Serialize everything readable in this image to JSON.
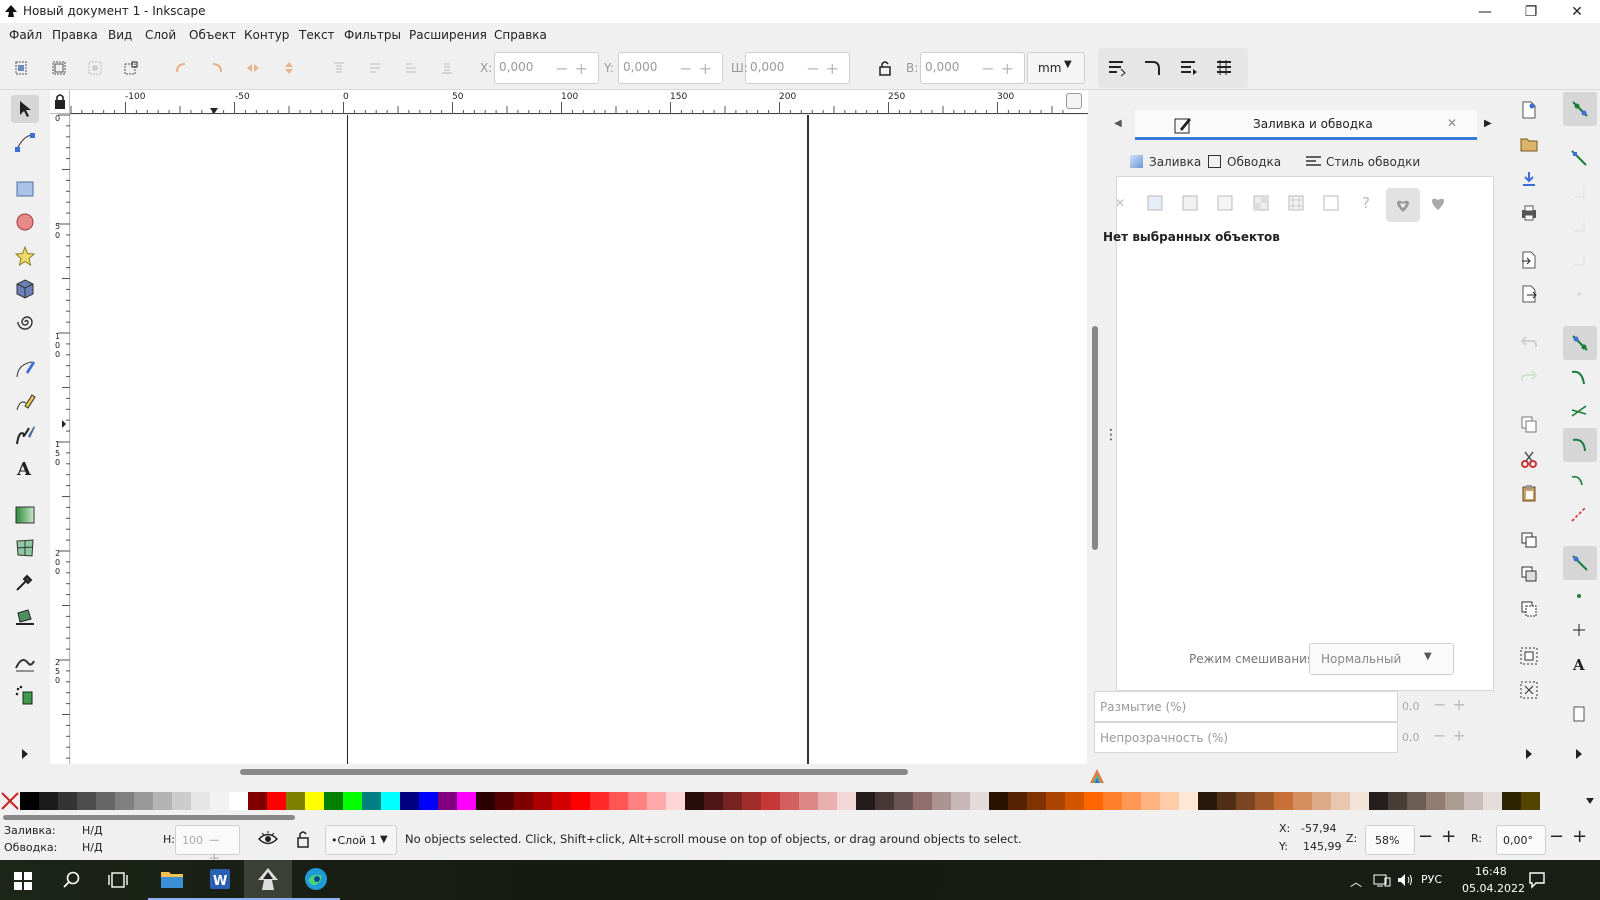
{
  "window": {
    "title": "Новый документ 1 - Inkscape",
    "min": "—",
    "max": "❐",
    "close": "✕"
  },
  "menu": [
    "Файл",
    "Правка",
    "Вид",
    "Слой",
    "Объект",
    "Контур",
    "Текст",
    "Фильтры",
    "Расширения",
    "Справка"
  ],
  "toolbar": {
    "x_label": "X:",
    "x_value": "0,000",
    "y_label": "Y:",
    "y_value": "0,000",
    "w_label": "Ш:",
    "w_value": "0,000",
    "h_label": "В:",
    "h_value": "0,000",
    "unit": "mm"
  },
  "ruler": {
    "h_ticks": [
      "-100",
      "-50",
      "0",
      "50",
      "100",
      "150",
      "200",
      "250",
      "300"
    ],
    "v_ticks": [
      "0",
      "50",
      "100",
      "150",
      "200",
      "250"
    ]
  },
  "dock": {
    "title": "Заливка и обводка",
    "tabs": [
      "Заливка",
      "Обводка",
      "Стиль обводки"
    ],
    "fill_buttons": [
      "none-icon",
      "flat-color-icon",
      "linear-gradient-icon",
      "radial-gradient-icon",
      "mesh-icon",
      "pattern-icon",
      "swatch-icon",
      "unset-icon",
      "winding-evenodd-icon",
      "winding-nonzero-icon"
    ],
    "unset_glyph": "?",
    "message": "Нет выбранных объектов",
    "blend_label": "Режим смешивания:",
    "blend_value": "Нормальный",
    "blur_label": "Размытие (%)",
    "blur_value": "0,0",
    "opacity_label": "Непрозрачность (%)",
    "opacity_value": "0,0"
  },
  "palette": {
    "colors": [
      "#000000",
      "#1a1a1a",
      "#333333",
      "#4d4d4d",
      "#666666",
      "#808080",
      "#999999",
      "#b3b3b3",
      "#cccccc",
      "#e6e6e6",
      "#f2f2f2",
      "#ffffff",
      "#800000",
      "#ff0000",
      "#808000",
      "#ffff00",
      "#008000",
      "#00ff00",
      "#008080",
      "#00ffff",
      "#000080",
      "#0000ff",
      "#800080",
      "#ff00ff",
      "#2b0000",
      "#550000",
      "#800000",
      "#aa0000",
      "#d40000",
      "#ff0000",
      "#ff2a2a",
      "#ff5555",
      "#ff8080",
      "#ffaaaa",
      "#ffd5d5",
      "#280b0b",
      "#501616",
      "#782121",
      "#a02c2c",
      "#c83737",
      "#d35f5f",
      "#de8787",
      "#e9afaf",
      "#f4d7d7",
      "#241c1c",
      "#483737",
      "#6c5353",
      "#916f6f",
      "#ac9393",
      "#c8b7b7",
      "#e3dbdb",
      "#2b1100",
      "#552200",
      "#803300",
      "#aa4400",
      "#d45500",
      "#ff6600",
      "#ff7f2a",
      "#ff9955",
      "#ffb380",
      "#ffccaa",
      "#ffe6d5",
      "#28170b",
      "#502d16",
      "#784421",
      "#a05a2c",
      "#c87137",
      "#d38d5f",
      "#deaa87",
      "#e9c6af",
      "#f4e3d7",
      "#241f1c",
      "#483e37",
      "#6c5d53",
      "#917c6f",
      "#ac9d93",
      "#c8beb7",
      "#e3dedb",
      "#2b2200",
      "#554400"
    ]
  },
  "status": {
    "fill_label": "Заливка:",
    "fill_value": "Н/Д",
    "stroke_label": "Обводка:",
    "stroke_value": "Н/Д",
    "h_label": "Н:",
    "h_value": "100",
    "layer": "•Слой 1",
    "message": "No objects selected. Click, Shift+click, Alt+scroll mouse on top of objects, or drag around objects to select.",
    "x_label": "X:",
    "x_value": "-57,94",
    "y_label": "Y:",
    "y_value": "145,99",
    "z_label": "Z:",
    "zoom": "58%",
    "r_label": "R:",
    "rotation": "0,00°"
  },
  "taskbar": {
    "lang": "РУС",
    "time": "16:48",
    "date": "05.04.2022"
  }
}
